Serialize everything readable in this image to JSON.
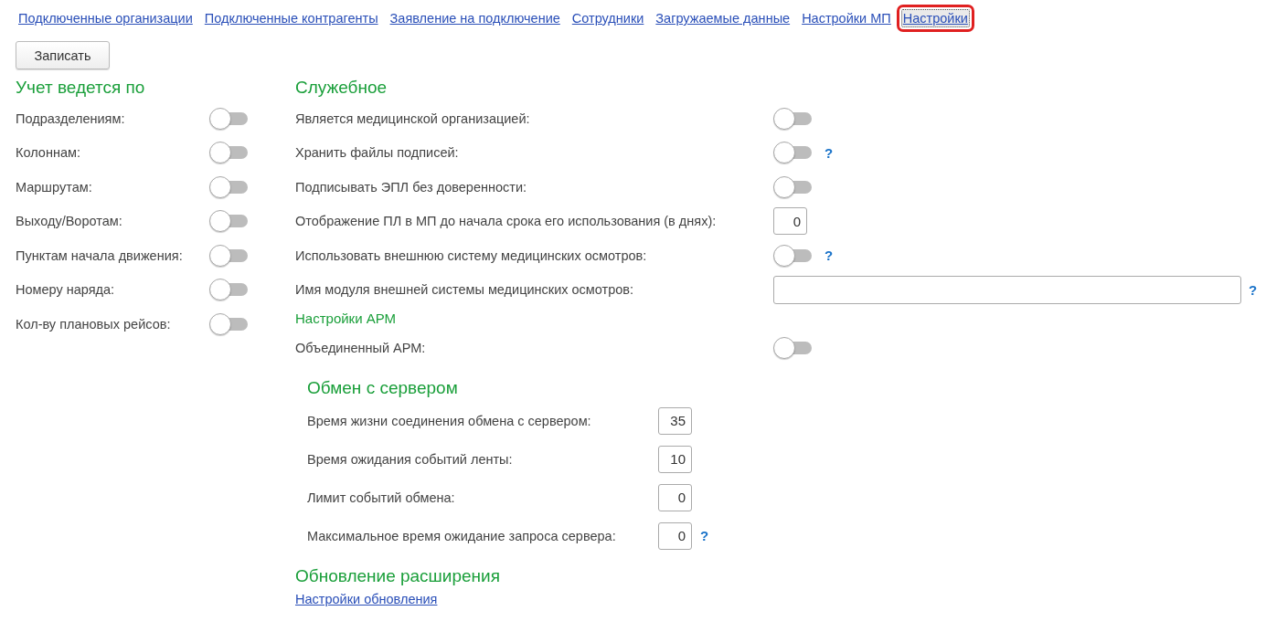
{
  "tabs": [
    {
      "label": "Подключенные организации",
      "selected": false
    },
    {
      "label": "Подключенные контрагенты",
      "selected": false
    },
    {
      "label": "Заявление на подключение",
      "selected": false
    },
    {
      "label": "Сотрудники",
      "selected": false
    },
    {
      "label": "Загружаемые данные",
      "selected": false
    },
    {
      "label": "Настройки МП",
      "selected": false
    },
    {
      "label": "Настройки",
      "selected": true
    }
  ],
  "save_button": "Записать",
  "accounting": {
    "title": "Учет ведется по",
    "toggles": [
      {
        "label": "Подразделениям:",
        "on": false
      },
      {
        "label": "Колоннам:",
        "on": false
      },
      {
        "label": "Маршрутам:",
        "on": false
      },
      {
        "label": "Выходу/Воротам:",
        "on": false
      },
      {
        "label": "Пунктам начала движения:",
        "on": false
      },
      {
        "label": "Номеру наряда:",
        "on": false
      },
      {
        "label": "Кол-ву плановых рейсов:",
        "on": false
      }
    ]
  },
  "service": {
    "title": "Служебное",
    "rows": [
      {
        "kind": "toggle",
        "label": "Является медицинской организацией:",
        "on": false
      },
      {
        "kind": "toggle",
        "label": "Хранить файлы подписей:",
        "on": false,
        "help": "?"
      },
      {
        "kind": "toggle",
        "label": "Подписывать ЭПЛ без доверенности:",
        "on": false
      },
      {
        "kind": "number",
        "label": "Отображение ПЛ в МП до начала срока его использования (в днях):",
        "value": "0"
      },
      {
        "kind": "toggle",
        "label": "Использовать внешнюю систему медицинских осмотров:",
        "on": false,
        "help": "?"
      },
      {
        "kind": "text",
        "label": "Имя модуля внешней системы медицинских осмотров:",
        "help": "?"
      }
    ]
  },
  "arm": {
    "title": "Настройки АРМ",
    "rows": [
      {
        "kind": "toggle",
        "label": "Объединенный АРМ:",
        "on": false
      }
    ]
  },
  "exchange": {
    "title": "Обмен с сервером",
    "rows": [
      {
        "label": "Время жизни соединения обмена с сервером:",
        "value": "35"
      },
      {
        "label": "Время ожидания событий ленты:",
        "value": "10"
      },
      {
        "label": "Лимит событий обмена:",
        "value": "0"
      },
      {
        "label": "Максимальное время ожидание запроса сервера:",
        "value": "0",
        "help": "?"
      }
    ]
  },
  "update": {
    "title": "Обновление расширения",
    "link": "Настройки обновления"
  }
}
